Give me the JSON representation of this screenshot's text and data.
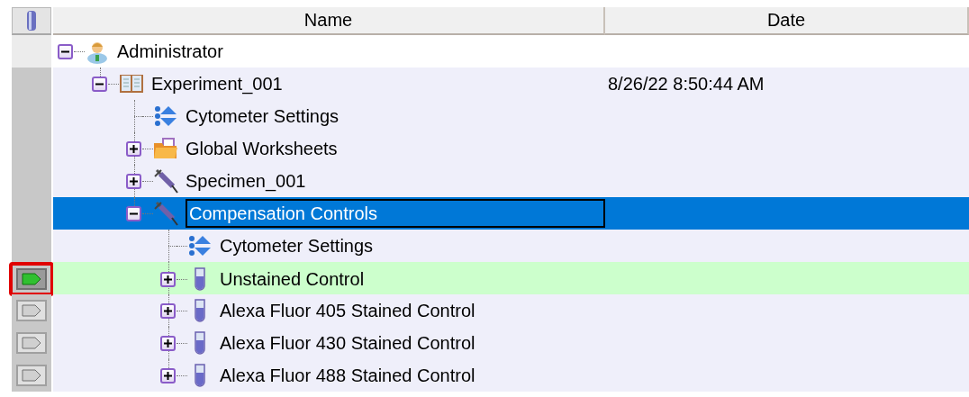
{
  "columns": [
    {
      "label": "Name"
    },
    {
      "label": "Date"
    }
  ],
  "tree": [
    {
      "kind": "user",
      "label": "Administrator",
      "expanded": true,
      "selected": false,
      "current": false,
      "children": [
        {
          "kind": "experiment",
          "label": "Experiment_001",
          "date": "8/26/22 8:50:44 AM",
          "expanded": true,
          "selected": false,
          "current": false,
          "children": [
            {
              "kind": "settings",
              "label": "Cytometer Settings",
              "selected": false,
              "current": false
            },
            {
              "kind": "worksheets",
              "label": "Global Worksheets",
              "expanded": false,
              "selected": false,
              "current": false
            },
            {
              "kind": "specimen",
              "label": "Specimen_001",
              "expanded": false,
              "selected": false,
              "current": false
            },
            {
              "kind": "specimen",
              "label": "Compensation Controls",
              "expanded": true,
              "selected": true,
              "current": false,
              "children": [
                {
                  "kind": "settings",
                  "label": "Cytometer Settings",
                  "selected": false,
                  "current": false
                },
                {
                  "kind": "tube",
                  "label": "Unstained Control",
                  "expanded": false,
                  "selected": false,
                  "current": true,
                  "pointer": {
                    "active": true
                  }
                },
                {
                  "kind": "tube",
                  "label": "Alexa Fluor 405 Stained Control",
                  "expanded": false,
                  "selected": false,
                  "current": false,
                  "pointer": {
                    "active": false
                  }
                },
                {
                  "kind": "tube",
                  "label": "Alexa Fluor 430 Stained Control",
                  "expanded": false,
                  "selected": false,
                  "current": false,
                  "pointer": {
                    "active": false
                  }
                },
                {
                  "kind": "tube",
                  "label": "Alexa Fluor 488 Stained Control",
                  "expanded": false,
                  "selected": false,
                  "current": false,
                  "pointer": {
                    "active": false
                  }
                }
              ]
            }
          ]
        }
      ]
    }
  ]
}
